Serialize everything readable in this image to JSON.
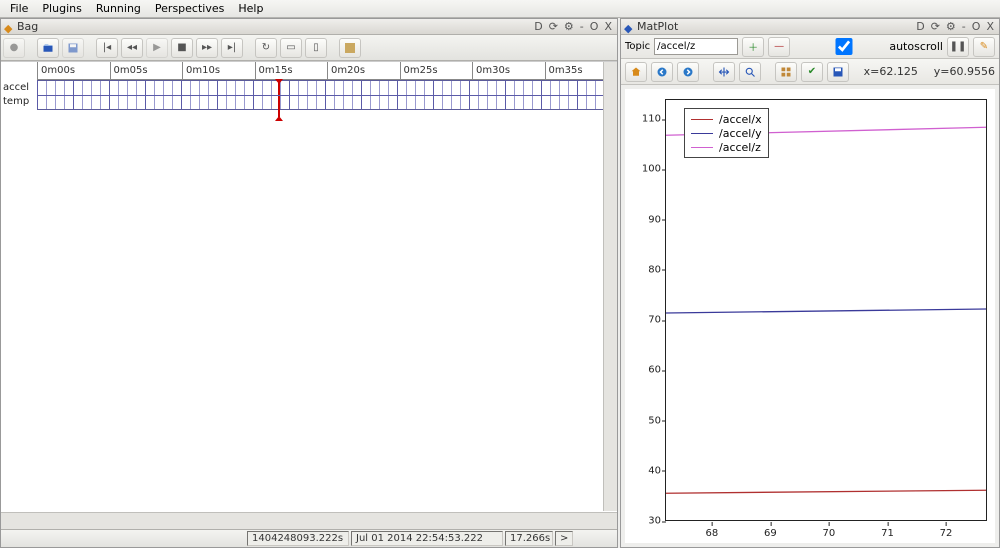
{
  "menu": {
    "items": [
      "File",
      "Plugins",
      "Running",
      "Perspectives",
      "Help"
    ]
  },
  "bag": {
    "title": "Bag",
    "timeline": {
      "ticks": [
        "0m00s",
        "0m05s",
        "0m10s",
        "0m15s",
        "0m20s",
        "0m25s",
        "0m30s",
        "0m35s"
      ],
      "rows": [
        "accel",
        "temp"
      ],
      "playhead_pct": 41.5
    },
    "status": {
      "epoch": "1404248093.222s",
      "datetime": "Jul 01 2014 22:54:53.222",
      "elapsed": "17.266s",
      "arrow": ">"
    },
    "winbtns": [
      "D",
      "⟳",
      "⚙",
      "-",
      "O",
      "X"
    ]
  },
  "mat": {
    "title": "MatPlot",
    "topic_label": "Topic",
    "topic_value": "/accel/z",
    "autoscroll_label": "autoscroll",
    "autoscroll": true,
    "coord_x_label": "x=",
    "coord_x": "62.125",
    "coord_y_label": "y=",
    "coord_y": "60.9556",
    "legend": [
      {
        "label": "/accel/x",
        "color": "#b03030"
      },
      {
        "label": "/accel/y",
        "color": "#3a3a9a"
      },
      {
        "label": "/accel/z",
        "color": "#d060d0"
      }
    ],
    "winbtns": [
      "D",
      "⟳",
      "⚙",
      "-",
      "O",
      "X"
    ]
  },
  "chart_data": {
    "type": "line",
    "xlabel": "",
    "ylabel": "",
    "xlim": [
      67.2,
      72.7
    ],
    "ylim": [
      30,
      114
    ],
    "xticks": [
      68,
      69,
      70,
      71,
      72
    ],
    "yticks": [
      30,
      40,
      50,
      60,
      70,
      80,
      90,
      100,
      110
    ],
    "series": [
      {
        "name": "/accel/x",
        "color": "#b03030",
        "x": [
          67.2,
          72.7
        ],
        "y": [
          35.3,
          35.9
        ]
      },
      {
        "name": "/accel/y",
        "color": "#3a3a9a",
        "x": [
          67.2,
          72.7
        ],
        "y": [
          71.4,
          72.2
        ]
      },
      {
        "name": "/accel/z",
        "color": "#d060d0",
        "x": [
          67.2,
          72.7
        ],
        "y": [
          107.0,
          108.6
        ]
      }
    ]
  }
}
